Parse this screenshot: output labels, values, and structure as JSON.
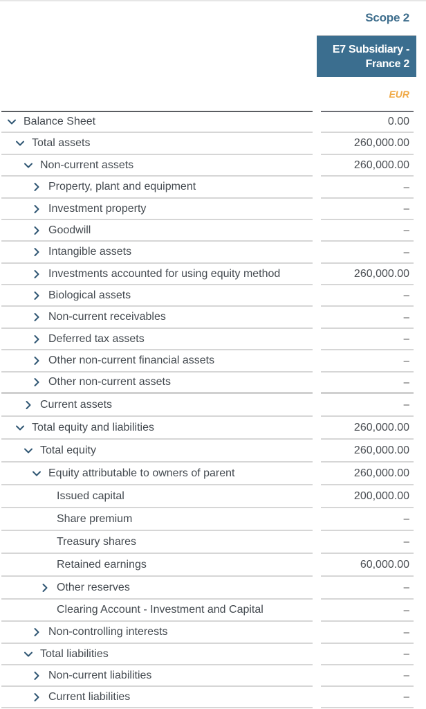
{
  "header": {
    "scope_label": "Scope 2",
    "entity_label": "E7 Subsidiary - France 2",
    "currency": "EUR"
  },
  "colors": {
    "entity_bg": "#3b6e8f",
    "scope_text": "#3d6d8c",
    "currency_text": "#f0a945",
    "chevron": "#2f5673"
  },
  "rows": [
    {
      "label": "Balance Sheet",
      "level": 0,
      "icon": "chevron-down-icon",
      "value": "0.00"
    },
    {
      "label": "Total assets",
      "level": 1,
      "icon": "chevron-down-icon",
      "value": "260,000.00"
    },
    {
      "label": "Non-current assets",
      "level": 2,
      "icon": "chevron-down-icon",
      "value": "260,000.00"
    },
    {
      "label": "Property, plant and equipment",
      "level": 3,
      "icon": "chevron-right-icon",
      "value": "–"
    },
    {
      "label": "Investment property",
      "level": 3,
      "icon": "chevron-right-icon",
      "value": "–"
    },
    {
      "label": "Goodwill",
      "level": 3,
      "icon": "chevron-right-icon",
      "value": "–"
    },
    {
      "label": "Intangible assets",
      "level": 3,
      "icon": "chevron-right-icon",
      "value": "–"
    },
    {
      "label": "Investments accounted for using equity method",
      "level": 3,
      "icon": "chevron-right-icon",
      "value": "260,000.00"
    },
    {
      "label": "Biological assets",
      "level": 3,
      "icon": "chevron-right-icon",
      "value": "–"
    },
    {
      "label": "Non-current receivables",
      "level": 3,
      "icon": "chevron-right-icon",
      "value": "–"
    },
    {
      "label": "Deferred tax assets",
      "level": 3,
      "icon": "chevron-right-icon",
      "value": "–"
    },
    {
      "label": "Other non-current financial assets",
      "level": 3,
      "icon": "chevron-right-icon",
      "value": "–"
    },
    {
      "label": "Other non-current assets",
      "level": 3,
      "icon": "chevron-right-icon",
      "value": "–"
    },
    {
      "label": "Current assets",
      "level": 2,
      "icon": "chevron-right-icon",
      "value": "–"
    },
    {
      "label": "Total equity and liabilities",
      "level": 1,
      "icon": "chevron-down-icon",
      "value": "260,000.00"
    },
    {
      "label": "Total equity",
      "level": 2,
      "icon": "chevron-down-icon",
      "value": "260,000.00"
    },
    {
      "label": "Equity attributable to owners of parent",
      "level": 3,
      "icon": "chevron-down-icon",
      "value": "260,000.00"
    },
    {
      "label": "Issued capital",
      "level": 4,
      "icon": "",
      "value": "200,000.00"
    },
    {
      "label": "Share premium",
      "level": 4,
      "icon": "",
      "value": "–"
    },
    {
      "label": "Treasury shares",
      "level": 4,
      "icon": "",
      "value": "–"
    },
    {
      "label": "Retained earnings",
      "level": 4,
      "icon": "",
      "value": "60,000.00"
    },
    {
      "label": "Other reserves",
      "level": 4,
      "icon": "chevron-right-icon",
      "value": "–"
    },
    {
      "label": "Clearing Account - Investment and Capital",
      "level": 4,
      "icon": "",
      "value": "–"
    },
    {
      "label": "Non-controlling interests",
      "level": 3,
      "icon": "chevron-right-icon",
      "value": "–"
    },
    {
      "label": "Total liabilities",
      "level": 2,
      "icon": "chevron-down-icon",
      "value": "–"
    },
    {
      "label": "Non-current liabilities",
      "level": 3,
      "icon": "chevron-right-icon",
      "value": "–"
    },
    {
      "label": "Current liabilities",
      "level": 3,
      "icon": "chevron-right-icon",
      "value": "–"
    }
  ]
}
